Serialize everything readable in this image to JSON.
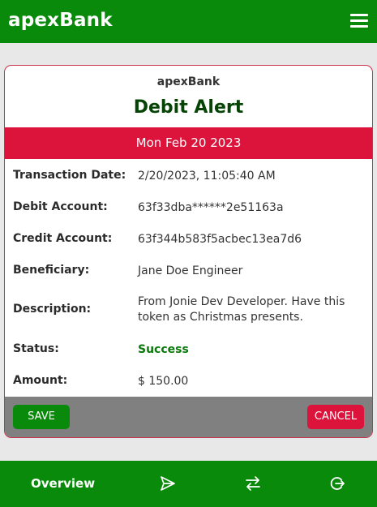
{
  "app": {
    "brand": "apexBank"
  },
  "card": {
    "brand": "apexBank",
    "title": "Debit Alert",
    "date_banner": "Mon Feb 20 2023",
    "fields": [
      {
        "label": "Transaction Date:",
        "value": "2/20/2023, 11:05:40 AM"
      },
      {
        "label": "Debit Account:",
        "value": "63f33dba******2e51163a"
      },
      {
        "label": "Credit Account:",
        "value": "63f344b583f5acbec13ea7d6"
      },
      {
        "label": "Beneficiary:",
        "value": "Jane Doe Engineer"
      },
      {
        "label": "Description:",
        "value": "From Jonie Dev Developer. Have this token as Christmas presents."
      },
      {
        "label": "Status:",
        "value": "Success"
      },
      {
        "label": "Amount:",
        "value": "$ 150.00"
      }
    ],
    "actions": {
      "save_label": "SAVE",
      "cancel_label": "CANCEL"
    }
  },
  "bottom_nav": {
    "overview_label": "Overview",
    "icons": [
      "send-icon",
      "transfer-icon",
      "logout-icon"
    ]
  },
  "colors": {
    "primary": "#0a8a0a",
    "accent": "#dc143c",
    "title": "#064406",
    "action_bar": "#808080"
  }
}
